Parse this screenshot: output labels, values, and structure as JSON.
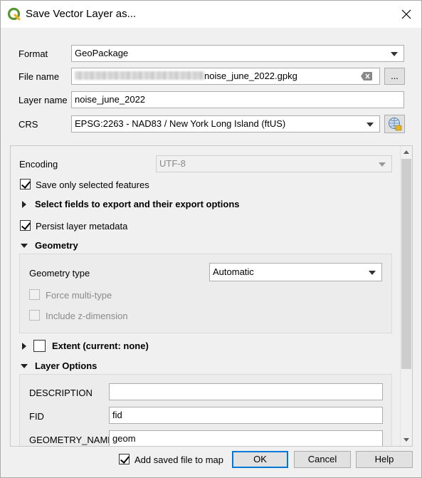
{
  "window": {
    "title": "Save Vector Layer as..."
  },
  "form": {
    "format_label": "Format",
    "format_value": "GeoPackage",
    "filename_label": "File name",
    "filename_value": "noise_june_2022.gpkg",
    "browse_label": "...",
    "layername_label": "Layer name",
    "layername_value": "noise_june_2022",
    "crs_label": "CRS",
    "crs_value": "EPSG:2263 - NAD83 / New York Long Island (ftUS)"
  },
  "options": {
    "encoding_label": "Encoding",
    "encoding_value": "UTF-8",
    "save_selected_label": "Save only selected features",
    "save_selected_checked": true,
    "select_fields_label": "Select fields to export and their export options",
    "persist_metadata_label": "Persist layer metadata",
    "persist_metadata_checked": true,
    "geometry_section": "Geometry",
    "geometry_type_label": "Geometry type",
    "geometry_type_value": "Automatic",
    "force_multi_label": "Force multi-type",
    "include_z_label": "Include z-dimension",
    "extent_label": "Extent (current: none)",
    "layer_options_section": "Layer Options",
    "layer_options": [
      {
        "key": "DESCRIPTION",
        "value": ""
      },
      {
        "key": "FID",
        "value": "fid"
      },
      {
        "key": "GEOMETRY_NAME",
        "value": "geom"
      }
    ]
  },
  "footer": {
    "add_to_map_label": "Add saved file to map",
    "add_to_map_checked": true,
    "ok_label": "OK",
    "cancel_label": "Cancel",
    "help_label": "Help"
  },
  "colors": {
    "qgis_green": "#589632",
    "accent_blue": "#0078d7"
  }
}
